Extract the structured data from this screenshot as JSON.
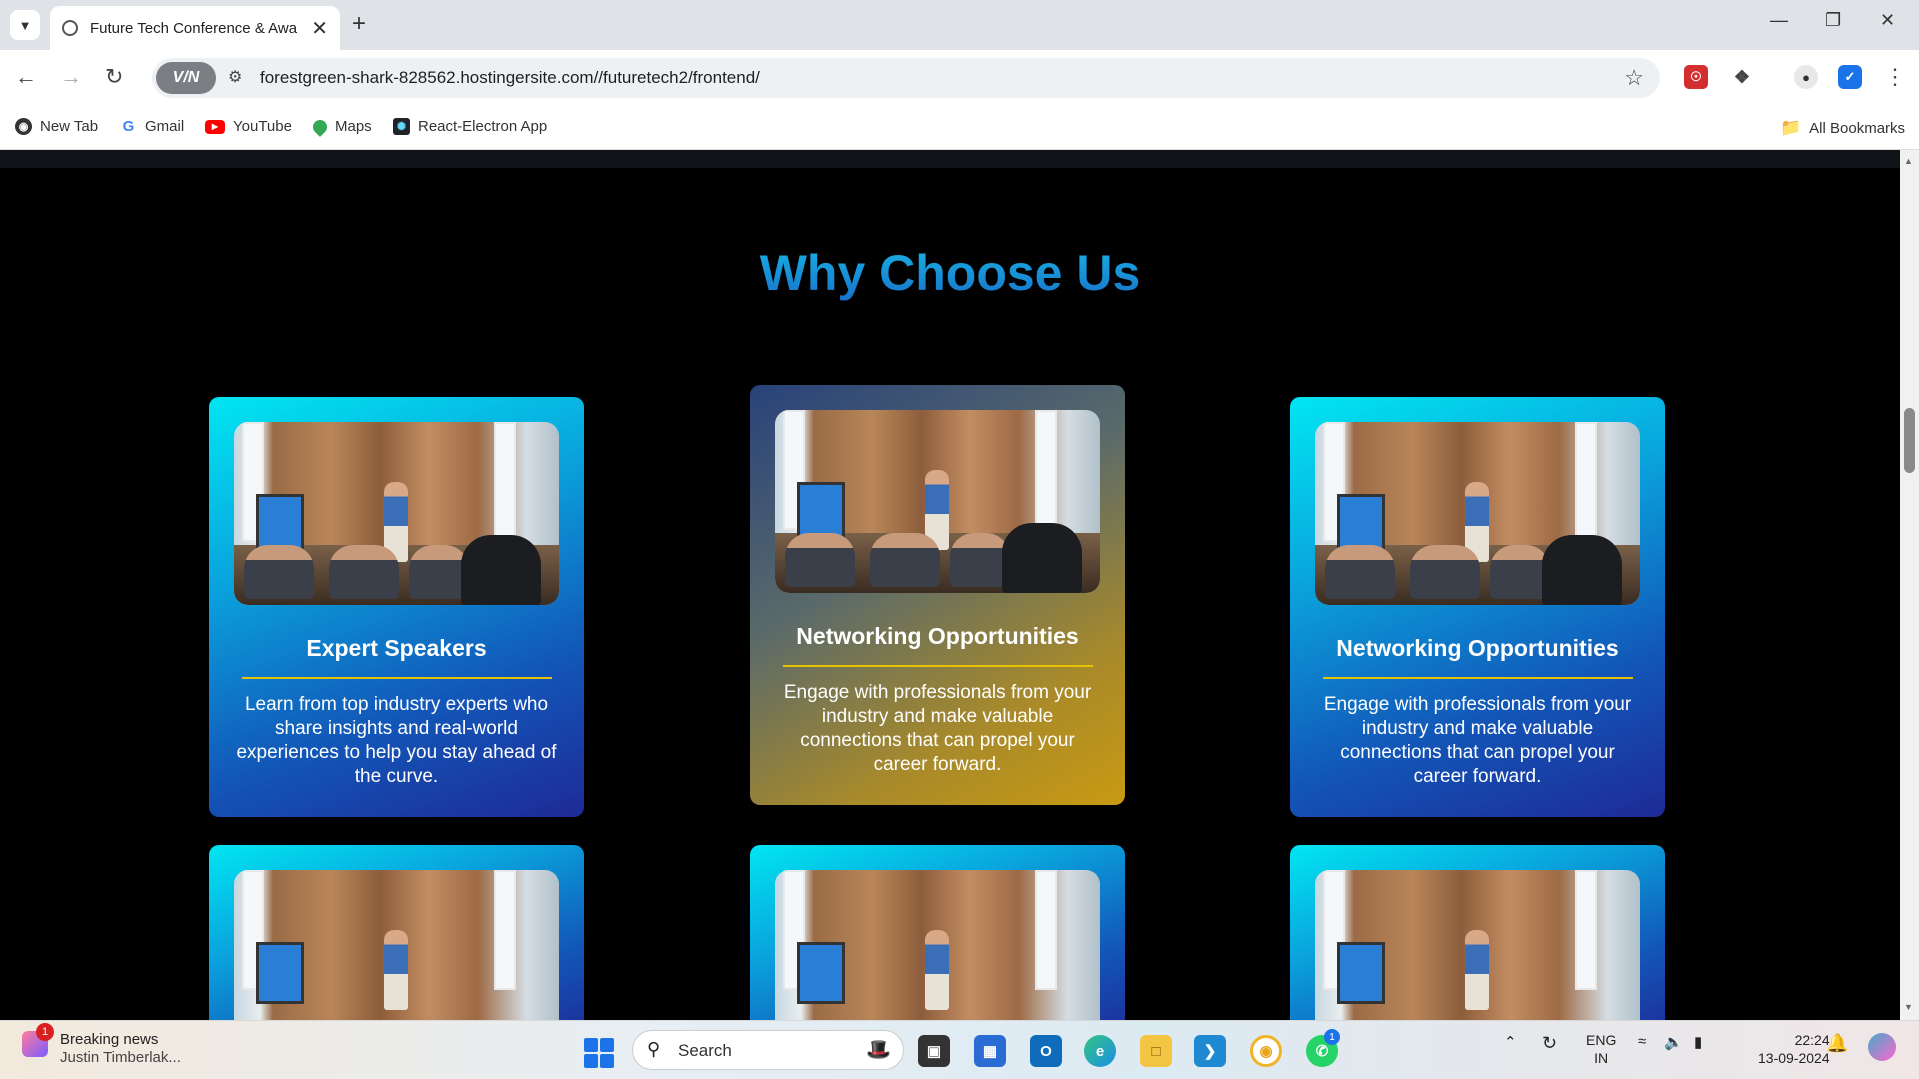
{
  "browser": {
    "tab_title": "Future Tech Conference & Awa",
    "url": "forestgreen-shark-828562.hostingersite.com//futuretech2/frontend/",
    "vpn_label": "V/N",
    "bookmarks": [
      {
        "label": "New Tab",
        "icon": "globe-icon",
        "color": "#333333"
      },
      {
        "label": "Gmail",
        "icon": "google-icon",
        "color": "#4285f4"
      },
      {
        "label": "YouTube",
        "icon": "youtube-icon",
        "color": "#ff0000"
      },
      {
        "label": "Maps",
        "icon": "maps-pin-icon",
        "color": "#34a853"
      },
      {
        "label": "React-Electron App",
        "icon": "react-icon",
        "color": "#20232a"
      }
    ],
    "all_bookmarks": "All Bookmarks"
  },
  "page": {
    "heading": "Why Choose Us",
    "cards": [
      {
        "title": "Expert Speakers",
        "text": "Learn from top industry experts who share insights and real-world experiences to help you stay ahead of the curve.",
        "style": "blue"
      },
      {
        "title": "Networking Opportunities",
        "text": "Engage with professionals from your industry and make valuable connections that can propel your career forward.",
        "style": "gold"
      },
      {
        "title": "Networking Opportunities",
        "text": "Engage with professionals from your industry and make valuable connections that can propel your career forward.",
        "style": "blue"
      }
    ]
  },
  "taskbar": {
    "news_title": "Breaking news",
    "news_sub": "Justin Timberlak...",
    "news_badge": "1",
    "search_label": "Search",
    "whatsapp_badge": "1",
    "lang_line1": "ENG",
    "lang_line2": "IN",
    "time": "22:24",
    "date": "13-09-2024"
  },
  "colors": {
    "heading": "#1e90d6",
    "card_blue_start": "#00e6f2",
    "card_blue_end": "#1e2a96",
    "card_gold_end": "#c99a12",
    "divider": "#e6c200"
  }
}
